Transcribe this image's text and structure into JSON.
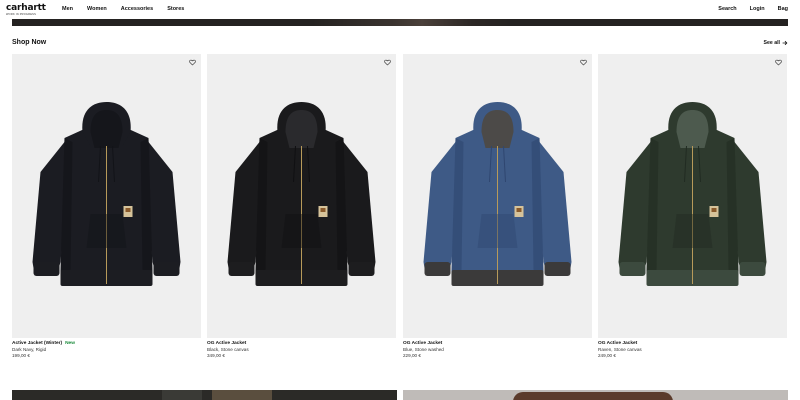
{
  "brand": {
    "name": "carhartt",
    "sub": "WORK IN PROGRESS"
  },
  "nav": {
    "left": [
      "Men",
      "Women",
      "Accessories",
      "Stores"
    ],
    "right": [
      "Search",
      "Login",
      "Bag"
    ]
  },
  "section": {
    "title": "Shop Now",
    "see_all": "See all"
  },
  "colors": {
    "badge_new": "#1a8a3a",
    "card_bg": "#efefef"
  },
  "products": [
    {
      "name": "Active Jacket (Winter)",
      "badge": "New",
      "color": "Dark Navy, Rigid",
      "price": "199,00 €",
      "swatch": {
        "body": "#1b1c22",
        "shade": "#121318",
        "collar": "#15161b",
        "trim": "#1c1d22"
      }
    },
    {
      "name": "OG Active Jacket",
      "badge": "",
      "color": "Black, Stone canvas",
      "price": "349,00 €",
      "swatch": {
        "body": "#1a1a1c",
        "shade": "#101012",
        "collar": "#2a2a2d",
        "trim": "#1d1d1f"
      }
    },
    {
      "name": "OG Active Jacket",
      "badge": "",
      "color": "Blue, Stone washed",
      "price": "229,00 €",
      "swatch": {
        "body": "#3e5a86",
        "shade": "#2f4670",
        "collar": "#4c4a48",
        "trim": "#3b3a3a"
      }
    },
    {
      "name": "OG Active Jacket",
      "badge": "",
      "color": "Raven, Stone canvas",
      "price": "249,00 €",
      "swatch": {
        "body": "#2e3a2e",
        "shade": "#212b22",
        "collar": "#4d5a4e",
        "trim": "#3c4a3e"
      }
    }
  ]
}
